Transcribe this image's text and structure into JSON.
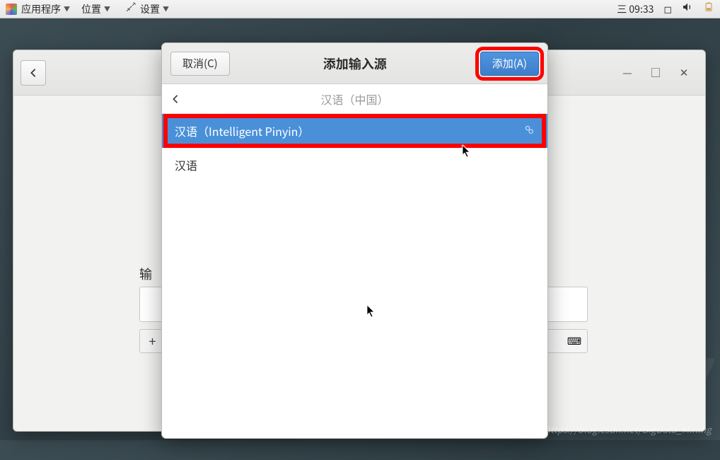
{
  "panel": {
    "apps_label": "应用程序",
    "places_label": "位置",
    "settings_label": "设置",
    "clock": "三 09:33"
  },
  "bg_window": {
    "input_label_partial": "输",
    "plus": "+",
    "kbd": "⌨"
  },
  "dialog": {
    "cancel_label": "取消(C)",
    "title": "添加输入源",
    "add_label": "添加(A)",
    "locale_title": "汉语（中国）",
    "sources": [
      {
        "label": "汉语（Intelligent Pinyin）",
        "selected": true,
        "has_gear": true
      },
      {
        "label": "汉语",
        "selected": false,
        "has_gear": false
      }
    ]
  },
  "watermark": "https://blog.csdn.net/BigData_Mining",
  "big7": "7"
}
